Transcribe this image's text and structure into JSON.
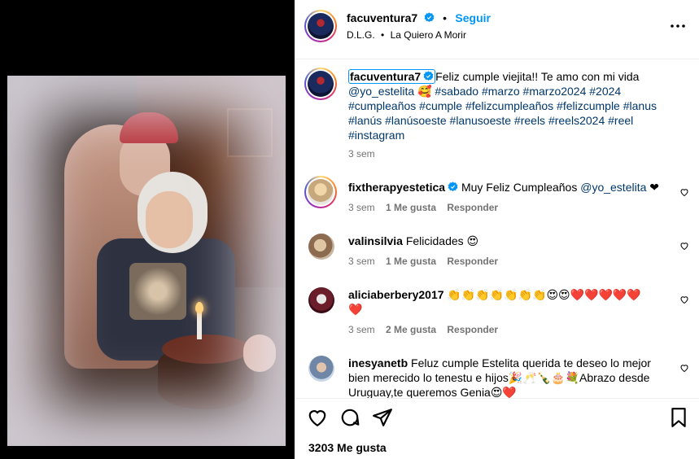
{
  "post": {
    "author": "facuventura7",
    "follow_label": "Seguir",
    "audio": {
      "artist": "D.L.G.",
      "song": "La Quiero A Morir"
    },
    "caption_author": "facuventura7",
    "caption_text": "Feliz cumple viejita!! Te amo con mi vida",
    "caption_emoji": "🥰",
    "caption_tags_line1": "@yo_estelita",
    "caption_tags_line1b": "#sabado #marzo #marzo2024 #2024",
    "caption_tags_line2": "#cumpleaños #cumple #felizcumpleaños #felizcumple #lanus",
    "caption_tags_line3": "#lanús #lanúsoeste #lanusoeste #reels #reels2024 #reel",
    "caption_tags_line4": "#instagram",
    "caption_time": "3 sem",
    "likes": "3203 Me gusta"
  },
  "comments": [
    {
      "user": "fixtherapyestetica",
      "verified": true,
      "text": "Muy Feliz Cumpleaños",
      "mention": "@yo_estelita",
      "suffix": "❤",
      "time": "3 sem",
      "likes": "1 Me gusta",
      "reply": "Responder"
    },
    {
      "user": "valinsilvia",
      "text": "Felicidades 😍",
      "time": "3 sem",
      "likes": "1 Me gusta",
      "reply": "Responder"
    },
    {
      "user": "aliciaberbery2017",
      "text": "👏👏👏👏👏👏👏😍😍❤️❤️❤️❤️❤️",
      "text2": "❤️",
      "time": "3 sem",
      "likes": "2 Me gusta",
      "reply": "Responder"
    },
    {
      "user": "inesyanetb",
      "text": "Feluz cumple Estelita querida te deseo lo mejor",
      "text2": "bien merecido lo tenestu e hijos🎉🥂🍾🎂💐Abrazo desde",
      "text3": "Uruguay,te queremos Genia😍❤️"
    }
  ],
  "icons": [
    "more-icon",
    "heart-icon",
    "comment-icon",
    "share-icon",
    "save-icon",
    "verified-icon"
  ]
}
